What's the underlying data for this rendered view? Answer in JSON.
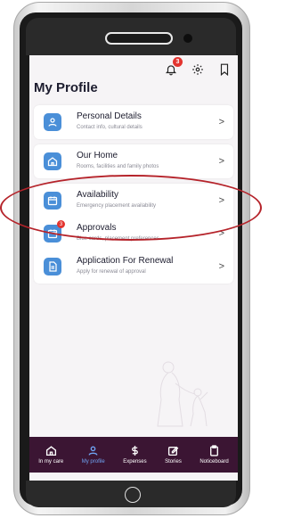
{
  "header": {
    "notification_count": "3",
    "icons": [
      "bell-icon",
      "gear-icon",
      "bookmark-icon"
    ]
  },
  "page": {
    "title": "My Profile"
  },
  "profile_items": [
    {
      "title": "Personal Details",
      "subtitle": "Contact info, cultural details",
      "icon": "person-icon"
    },
    {
      "title": "Our Home",
      "subtitle": "Rooms, facilities and family photos",
      "icon": "home-icon"
    },
    {
      "title": "Availability",
      "subtitle": "Emergency placement availability",
      "icon": "calendar-icon"
    },
    {
      "title": "Approvals",
      "subtitle": "Blue cards, placement preferences",
      "icon": "calendar-icon",
      "badge": "3"
    },
    {
      "title": "Application For Renewal",
      "subtitle": "Apply for renewal of approval",
      "icon": "document-icon"
    }
  ],
  "chevron": ">",
  "bottom_nav": [
    {
      "label": "In my care",
      "icon": "home-icon"
    },
    {
      "label": "My profile",
      "icon": "person-icon",
      "active": true
    },
    {
      "label": "Expenses",
      "icon": "dollar-icon"
    },
    {
      "label": "Stories",
      "icon": "edit-icon"
    },
    {
      "label": "Noticeboard",
      "icon": "clipboard-icon"
    }
  ],
  "colors": {
    "accent": "#4a8fd8",
    "nav_background": "#3b1533",
    "nav_active": "#6fa4f4",
    "badge": "#e3342f",
    "highlight": "#b5232a"
  }
}
